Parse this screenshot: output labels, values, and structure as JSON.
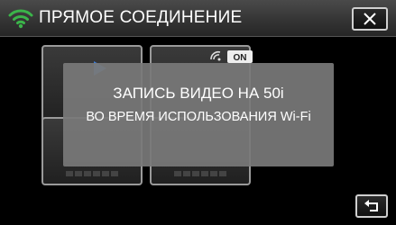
{
  "header": {
    "title": "ПРЯМОЕ СОЕДИНЕНИЕ",
    "wifi_icon": "wifi-icon",
    "close_icon": "close-icon"
  },
  "tiles": [
    {
      "icon": "play-icon"
    },
    {
      "icon": "tv-on-icon",
      "badge": "ON"
    },
    {
      "icon": null
    },
    {
      "icon": null
    }
  ],
  "overlay": {
    "line1": "ЗАПИСЬ ВИДЕО НА 50i",
    "line2": "ВО ВРЕМЯ ИСПОЛЬЗОВАНИЯ Wi-Fi"
  },
  "footer": {
    "back_icon": "return-arrow-icon"
  },
  "colors": {
    "wifi": "#3bb54a",
    "accent": "#3a7bd5",
    "overlay": "#787878"
  }
}
